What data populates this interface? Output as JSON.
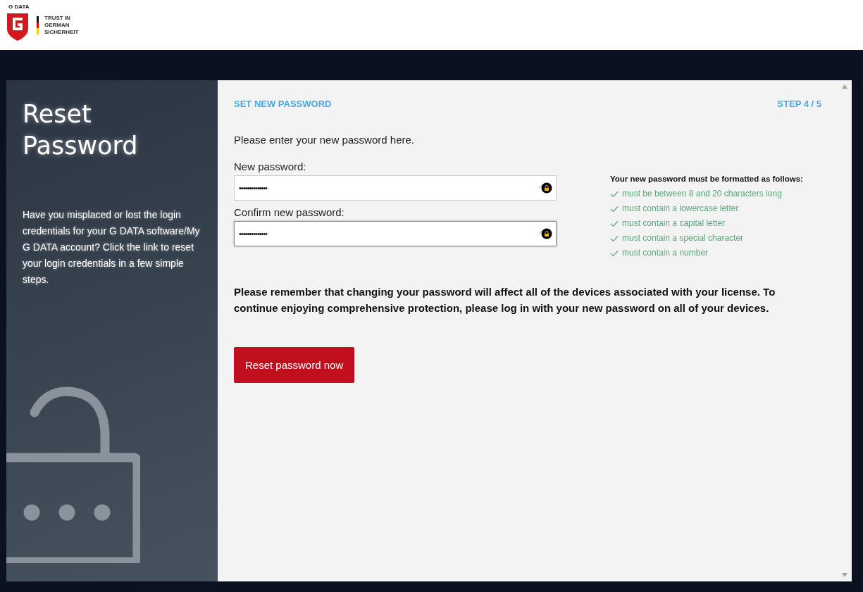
{
  "header": {
    "logo_text": "G DATA",
    "tagline": [
      "TRUST IN",
      "GERMAN",
      "SICHERHEIT"
    ]
  },
  "sidebar": {
    "title": "Reset Password",
    "description": "Have you misplaced or lost the login credentials for your G DATA software/My G DATA account? Click the link to reset your login credentials in a few simple steps."
  },
  "form": {
    "section_title": "SET NEW PASSWORD",
    "step": "STEP 4 / 5",
    "intro": "Please enter your new password here.",
    "fields": [
      {
        "label": "New password:",
        "value": "••••••••••••••",
        "focused": false
      },
      {
        "label": "Confirm new password:",
        "value": "••••••••••••••",
        "focused": true
      }
    ],
    "rules_title": "Your new password must be formatted as follows:",
    "rules": [
      {
        "text": "must be between 8 and 20 characters long",
        "met": true
      },
      {
        "text": "must contain a lowercase letter",
        "met": true
      },
      {
        "text": "must contain a capital letter",
        "met": true
      },
      {
        "text": "must contain a special character",
        "met": true
      },
      {
        "text": "must contain a number",
        "met": true
      }
    ],
    "notice": "Please remember that changing your password will affect all of the devices associated with your license. To continue enjoying comprehensive protection, please log in with your new password on all of your devices.",
    "submit": "Reset password now"
  }
}
